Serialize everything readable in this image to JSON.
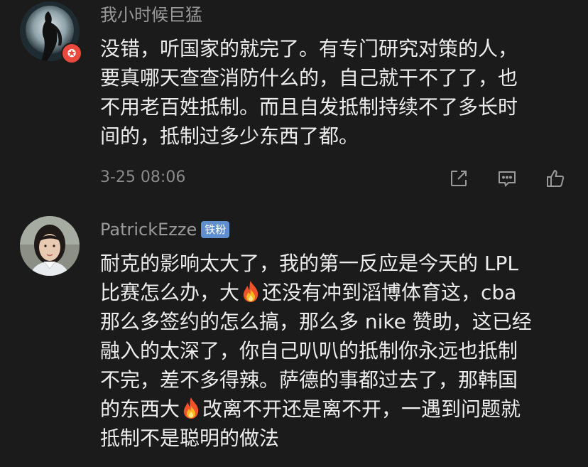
{
  "comments": [
    {
      "username": "我小时候巨猛",
      "badge_icon": "star-badge-icon",
      "body_lines": [
        "没错，听国家的就完了。有专门研究对策的人，",
        "要真哪天查查消防什么的，自己就干不了了，也",
        "不用老百姓抵制。而且自发抵制持续不了多长时",
        "间的，抵制过多少东西了都。"
      ],
      "timestamp": "3-25 08:06",
      "actions": [
        "share-icon",
        "reply-icon",
        "like-icon"
      ]
    },
    {
      "username": "PatrickEzze",
      "fan_badge": "铁粉",
      "body_lines": [
        [
          "耐克的影响太大了，我的第一反应是今天的 LPL"
        ],
        [
          "比赛怎么办，大",
          "还没有冲到滔博体育这，cba"
        ],
        [
          "那么多签约的怎么搞，那么多 nike 赞助，这已经"
        ],
        [
          "融入的太深了，你自己叭叭的抵制你永远也抵制"
        ],
        [
          "不完，差不多得辣。萨德的事都过去了，那韩国"
        ],
        [
          "的东西大",
          "改离不开还是离不开，一遇到问题就"
        ],
        [
          "抵制不是聪明的做法"
        ]
      ],
      "inline_icon": "fire-emoji-icon"
    }
  ],
  "colors": {
    "background": "#1b1b1b",
    "username": "#9a9a9a",
    "body_text": "#ececec",
    "timestamp": "#8a8a8a",
    "badge_red": "#e94a3d",
    "fan_badge_blue": "#5f8fcf"
  }
}
